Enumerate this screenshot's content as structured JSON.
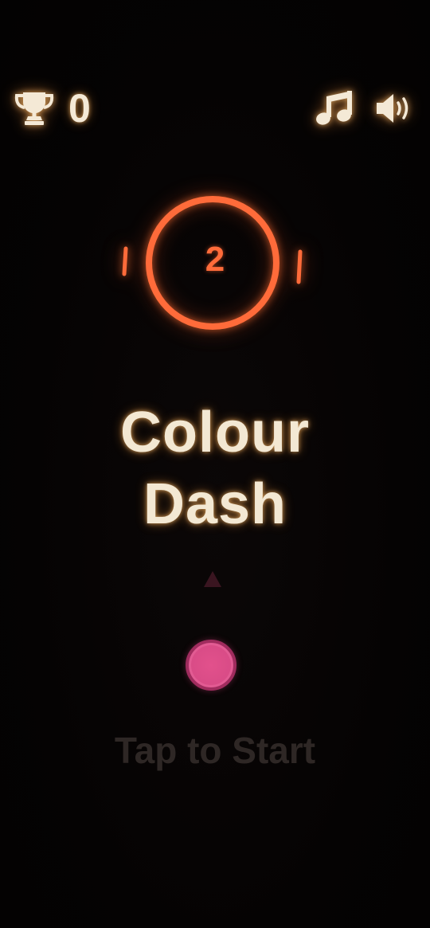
{
  "hud": {
    "score_icon": "trophy-icon",
    "score": "0",
    "music_icon": "music-note-icon",
    "sound_icon": "speaker-volume-icon"
  },
  "logo": {
    "ring_number": "2"
  },
  "title": {
    "line1": "Colour",
    "line2": "Dash"
  },
  "start": {
    "label": "Tap to Start"
  },
  "colors": {
    "background": "#050303",
    "hud_text": "#f4e9d6",
    "ring": "#ff6b3a",
    "ball": "#d84b86",
    "arrow": "#3a1520",
    "tap_text": "#2e2725"
  }
}
